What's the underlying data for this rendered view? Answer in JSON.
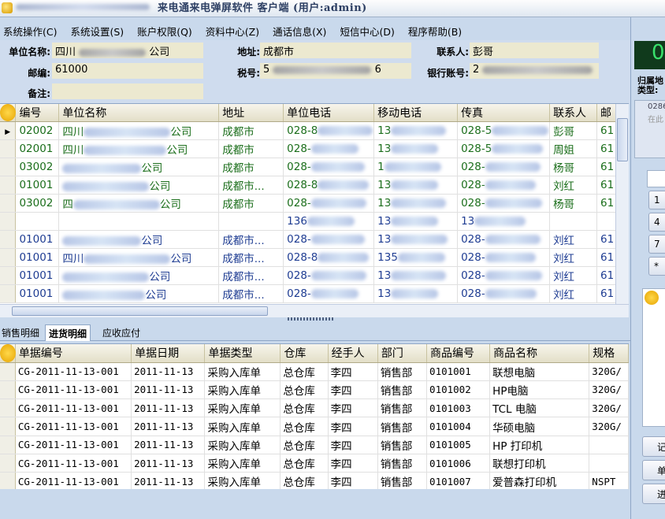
{
  "window": {
    "title": "来电通来电弹屏软件 客户端 (用户:admin)"
  },
  "menu": [
    {
      "label": "系统操作(C)"
    },
    {
      "label": "系统设置(S)"
    },
    {
      "label": "账户权限(Q)"
    },
    {
      "label": "资料中心(Z)"
    },
    {
      "label": "通话信息(X)"
    },
    {
      "label": "短信中心(D)"
    },
    {
      "label": "程序帮助(B)"
    }
  ],
  "form": {
    "unit_name_label": "单位名称:",
    "unit_name_value": "四川",
    "unit_name_suffix": "公司",
    "address_label": "地址:",
    "address_value": "成都市",
    "contact_label": "联系人:",
    "contact_value": "彭哥",
    "postcode_label": "邮编:",
    "postcode_value": "61000",
    "tax_label": "税号:",
    "tax_value_start": "5",
    "tax_value_end": "6",
    "bank_label": "银行账号:",
    "bank_value_start": "2",
    "notes_label": "备注:",
    "notes_value": ""
  },
  "customers": {
    "columns": [
      "编号",
      "单位名称",
      "地址",
      "单位电话",
      "移动电话",
      "传真",
      "联系人",
      "邮"
    ],
    "rows": [
      {
        "code": "02002",
        "name": "四川",
        "name_suffix": "公司",
        "address": "成都市",
        "phone": "028-8",
        "mobile": "13",
        "fax": "028-5",
        "contact": "彭哥",
        "post": "61",
        "color": "green",
        "current": true
      },
      {
        "code": "02001",
        "name": "四川",
        "name_suffix": "公司",
        "address": "成都市",
        "phone": "028-",
        "mobile": "13",
        "fax": "028-5",
        "contact": "周姐",
        "post": "61",
        "color": "green"
      },
      {
        "code": "03002",
        "name": "",
        "name_suffix": "公司",
        "address": "成都市",
        "phone": "028-",
        "mobile": "1",
        "fax": "028-",
        "contact": "杨哥",
        "post": "61",
        "color": "green"
      },
      {
        "code": "01001",
        "name": "",
        "name_suffix": "公司",
        "address": "成都市...",
        "phone": "028-8",
        "mobile": "13",
        "fax": "028-",
        "contact": "刘红",
        "post": "61",
        "color": "green"
      },
      {
        "code": "03002",
        "name": "四",
        "name_suffix": "公司",
        "address": "成都市",
        "phone": "028-",
        "mobile": "13",
        "fax": "028-",
        "contact": "杨哥",
        "post": "61",
        "color": "green"
      },
      {
        "code": "",
        "name": "",
        "name_suffix": "",
        "address": "",
        "phone": "136",
        "mobile": "13",
        "fax": "13",
        "contact": "",
        "post": "",
        "color": "blue"
      },
      {
        "code": "01001",
        "name": "",
        "name_suffix": "公司",
        "address": "成都市...",
        "phone": "028-",
        "mobile": "13",
        "fax": "028-",
        "contact": "刘红",
        "post": "61",
        "color": "blue"
      },
      {
        "code": "01001",
        "name": "四川",
        "name_suffix": "公司",
        "address": "成都市...",
        "phone": "028-8",
        "mobile": "135",
        "fax": "028-",
        "contact": "刘红",
        "post": "61",
        "color": "blue"
      },
      {
        "code": "01001",
        "name": "",
        "name_suffix": "公司",
        "address": "成都市...",
        "phone": "028-",
        "mobile": "13",
        "fax": "028-",
        "contact": "刘红",
        "post": "61",
        "color": "blue"
      },
      {
        "code": "01001",
        "name": "",
        "name_suffix": "公司",
        "address": "成都市...",
        "phone": "028-",
        "mobile": "13",
        "fax": "028-",
        "contact": "刘红",
        "post": "61",
        "color": "blue"
      }
    ]
  },
  "tabs": [
    {
      "label": "销售明细"
    },
    {
      "label": "进货明细",
      "active": true
    },
    {
      "label": "应收应付"
    }
  ],
  "purchases": {
    "columns": [
      "单据编号",
      "单据日期",
      "单据类型",
      "仓库",
      "经手人",
      "部门",
      "商品编号",
      "商品名称",
      "规格"
    ],
    "rows": [
      {
        "bill_no": "CG-2011-11-13-001",
        "date": "2011-11-13",
        "type": "采购入库单",
        "warehouse": "总仓库",
        "handler": "李四",
        "dept": "销售部",
        "item_no": "0101001",
        "item_name": "联想电脑",
        "spec": "320G/"
      },
      {
        "bill_no": "CG-2011-11-13-001",
        "date": "2011-11-13",
        "type": "采购入库单",
        "warehouse": "总仓库",
        "handler": "李四",
        "dept": "销售部",
        "item_no": "0101002",
        "item_name": "HP电脑",
        "spec": "320G/"
      },
      {
        "bill_no": "CG-2011-11-13-001",
        "date": "2011-11-13",
        "type": "采购入库单",
        "warehouse": "总仓库",
        "handler": "李四",
        "dept": "销售部",
        "item_no": "0101003",
        "item_name": "TCL 电脑",
        "spec": "320G/"
      },
      {
        "bill_no": "CG-2011-11-13-001",
        "date": "2011-11-13",
        "type": "采购入库单",
        "warehouse": "总仓库",
        "handler": "李四",
        "dept": "销售部",
        "item_no": "0101004",
        "item_name": "华硕电脑",
        "spec": "320G/"
      },
      {
        "bill_no": "CG-2011-11-13-001",
        "date": "2011-11-13",
        "type": "采购入库单",
        "warehouse": "总仓库",
        "handler": "李四",
        "dept": "销售部",
        "item_no": "0101005",
        "item_name": "HP 打印机",
        "spec": ""
      },
      {
        "bill_no": "CG-2011-11-13-001",
        "date": "2011-11-13",
        "type": "采购入库单",
        "warehouse": "总仓库",
        "handler": "李四",
        "dept": "销售部",
        "item_no": "0101006",
        "item_name": "联想打印机",
        "spec": ""
      },
      {
        "bill_no": "CG-2011-11-13-001",
        "date": "2011-11-13",
        "type": "采购入库单",
        "warehouse": "总仓库",
        "handler": "李四",
        "dept": "销售部",
        "item_no": "0101007",
        "item_name": "爱普森打印机",
        "spec": "NSPT"
      }
    ]
  },
  "right_panel": {
    "big_digit": "0",
    "label1": "归属地",
    "label2": "类型:",
    "number_snippet": "0286",
    "placeholder": "在此",
    "keys": [
      "1",
      "4",
      "7",
      "*"
    ],
    "buttons": [
      "记",
      "单位",
      "进"
    ]
  },
  "colors": {
    "accent_green": "#1b6e1b",
    "accent_blue": "#1e3c92",
    "frame": "#c9d9ec",
    "header": "#e3dfc8"
  }
}
